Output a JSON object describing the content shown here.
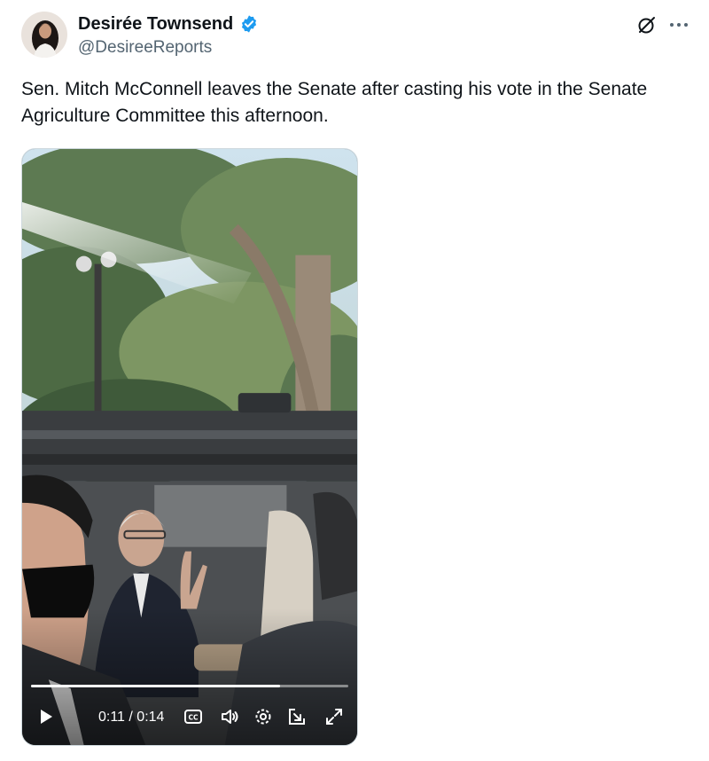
{
  "author": {
    "name": "Desirée Townsend",
    "handle": "@DesireeReports",
    "verified": true
  },
  "header_icons": [
    "grok-icon",
    "more-options-icon"
  ],
  "post": {
    "text": "Sen. Mitch McConnell leaves the Senate after casting his vote in the Senate Agriculture Committee this afternoon."
  },
  "video": {
    "time_display": "0:11 / 0:14",
    "current_seconds": 11,
    "total_seconds": 14,
    "controls": [
      "play-icon",
      "captions-icon",
      "volume-icon",
      "settings-icon",
      "pip-icon",
      "fullscreen-icon"
    ]
  },
  "colors": {
    "text_primary": "#0f1419",
    "text_secondary": "#536471",
    "verified_blue": "#1d9bf0"
  }
}
